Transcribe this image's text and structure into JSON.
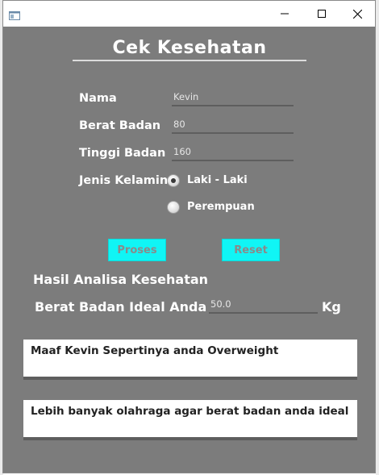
{
  "window": {
    "title": "",
    "icons": {
      "app": "java-window-icon",
      "minimize": "minimize-icon",
      "maximize": "maximize-icon",
      "close": "close-icon"
    }
  },
  "form": {
    "title": "Cek Kesehatan",
    "labels": {
      "nama": "Nama",
      "berat": "Berat Badan",
      "tinggi": "Tinggi Badan",
      "jenis_kelamin": "Jenis Kelamin"
    },
    "values": {
      "nama": "Kevin",
      "berat": "80",
      "tinggi": "160"
    },
    "gender_options": [
      {
        "label": "Laki - Laki",
        "selected": true
      },
      {
        "label": "Perempuan",
        "selected": false
      }
    ],
    "buttons": {
      "proses": "Proses",
      "reset": "Reset"
    }
  },
  "result": {
    "heading": "Hasil Analisa Kesehatan",
    "ideal_label": "Berat Badan Ideal Anda",
    "ideal_value": "50.0",
    "unit": "Kg",
    "message1": "Maaf Kevin Sepertinya anda Overweight",
    "message2": "Lebih banyak olahraga agar berat badan anda ideal"
  },
  "colors": {
    "panel": "#7c7c7c",
    "button": "#10f5f5",
    "button_text": "#8a8a8a"
  }
}
